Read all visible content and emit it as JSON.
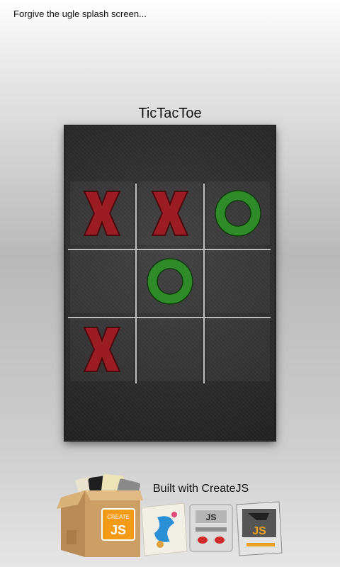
{
  "splash_note": "Forgive the ugle splash screen...",
  "title": "TicTacToe",
  "board": [
    [
      "X",
      "X",
      "O"
    ],
    [
      "",
      "O",
      ""
    ],
    [
      "X",
      "",
      ""
    ]
  ],
  "footer": {
    "label": "Built with CreateJS",
    "box_label": "CREATE",
    "box_badge": "JS"
  },
  "colors": {
    "x_mark": "#9b1c24",
    "o_mark": "#2f8a2a",
    "board_bg": "#2e2e2e",
    "grid_line": "#bdbdbd"
  }
}
